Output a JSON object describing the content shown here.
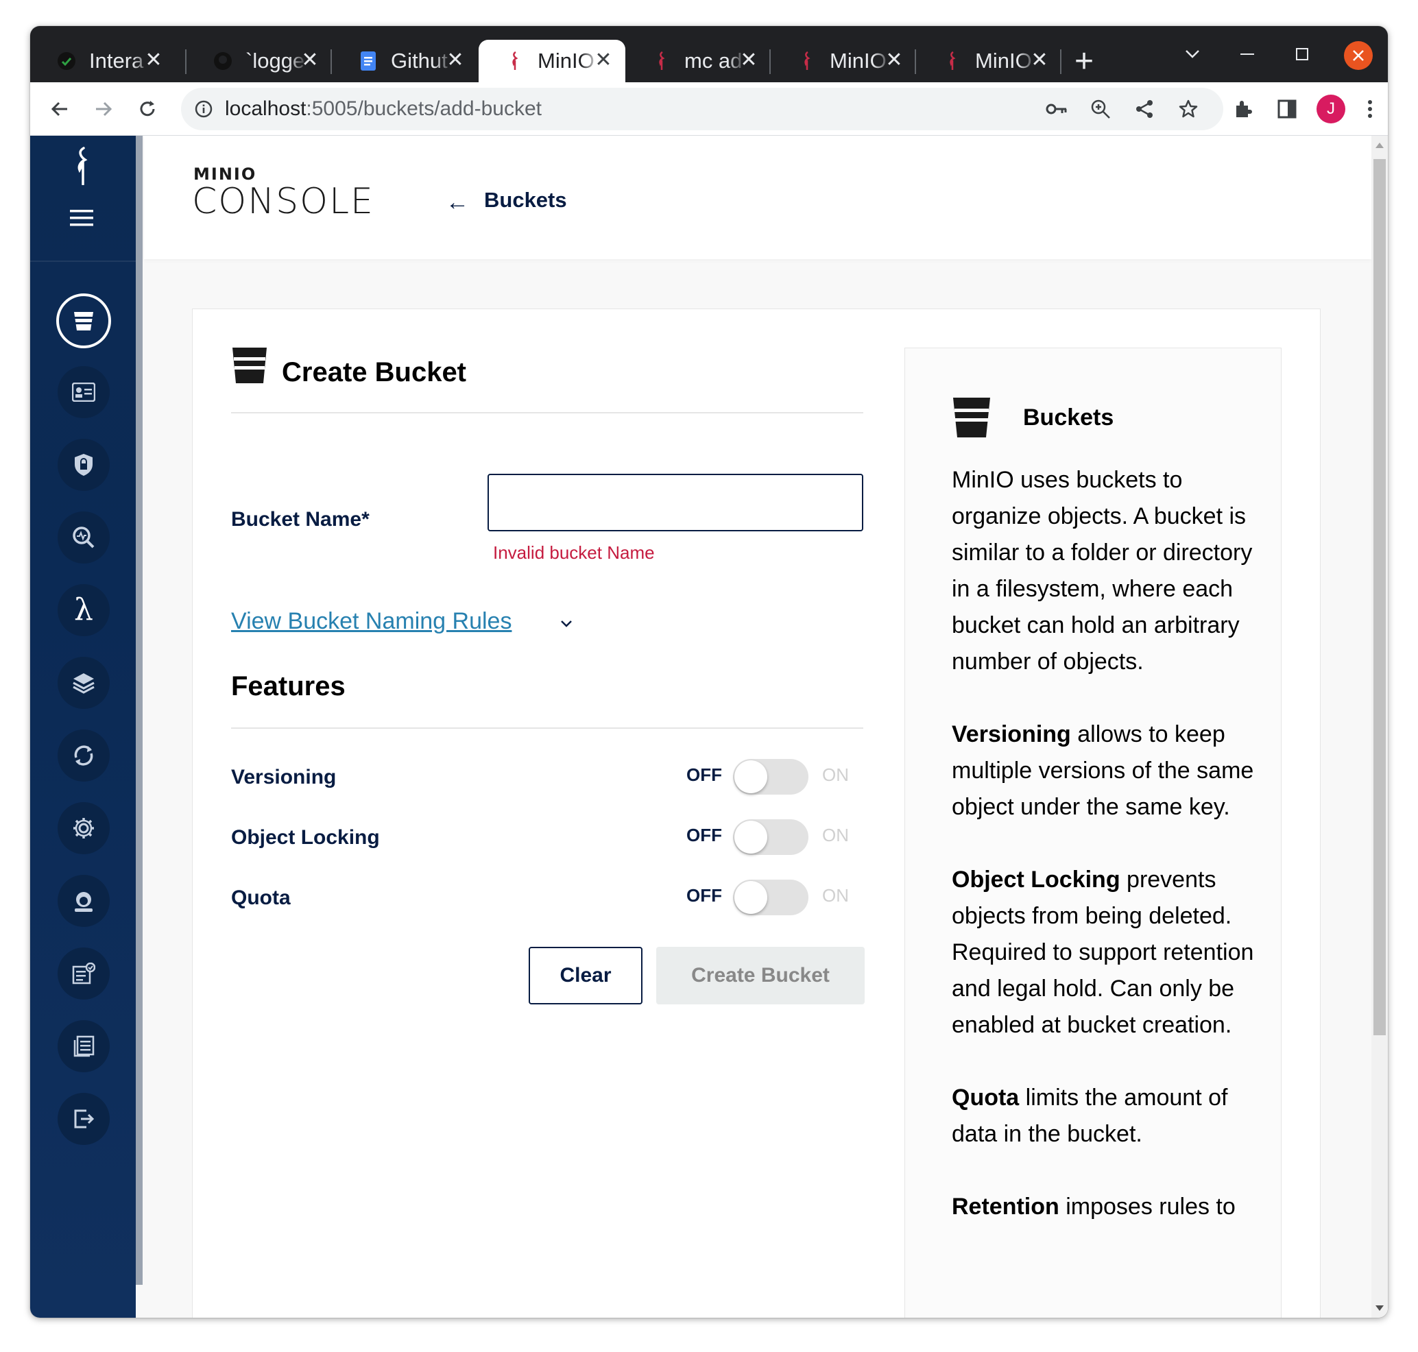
{
  "browser": {
    "tabs": [
      {
        "title": "Intera",
        "icon": "github-icon"
      },
      {
        "title": "`logge",
        "icon": "github-icon"
      },
      {
        "title": "Githut",
        "icon": "docs-icon"
      },
      {
        "title": "MinIO",
        "icon": "minio-icon",
        "active": true
      },
      {
        "title": "mc ad",
        "icon": "minio-icon"
      },
      {
        "title": "MinIO",
        "icon": "minio-icon"
      },
      {
        "title": "MinIO",
        "icon": "minio-icon"
      }
    ],
    "url_host": "localhost",
    "url_rest": ":5005/buckets/add-bucket",
    "profile_initial": "J",
    "accent": "#e95420"
  },
  "header": {
    "logo_top": "MINIO",
    "logo_main": "CONSOLE",
    "back_arrow": "←",
    "back_label": "Buckets"
  },
  "form": {
    "title": "Create Bucket",
    "bucket_name_label": "Bucket Name*",
    "bucket_name_value": "",
    "error": "Invalid bucket Name",
    "rules_link": "View Bucket Naming Rules",
    "features_title": "Features",
    "features": [
      {
        "label": "Versioning",
        "off": "OFF",
        "on": "ON"
      },
      {
        "label": "Object Locking",
        "off": "OFF",
        "on": "ON"
      },
      {
        "label": "Quota",
        "off": "OFF",
        "on": "ON"
      }
    ],
    "clear_label": "Clear",
    "create_label": "Create Bucket"
  },
  "help": {
    "title": "Buckets",
    "intro": "MinIO uses buckets to organize objects. A bucket is similar to a folder or directory in a filesystem, where each bucket can hold an arbitrary number of objects.",
    "versioning_term": "Versioning",
    "versioning_text": " allows to keep multiple versions of the same object under the same key.",
    "locking_term": "Object Locking",
    "locking_text": " prevents objects from being deleted. Required to support retention and legal hold. Can only be enabled at bucket creation.",
    "quota_term": "Quota",
    "quota_text": " limits the amount of data in the bucket.",
    "retention_term": "Retention",
    "retention_text": " imposes rules to"
  },
  "colors": {
    "navy": "#081c42",
    "sidebar": "#0c2a53",
    "error": "#c51b3f",
    "link": "#2781b0"
  }
}
